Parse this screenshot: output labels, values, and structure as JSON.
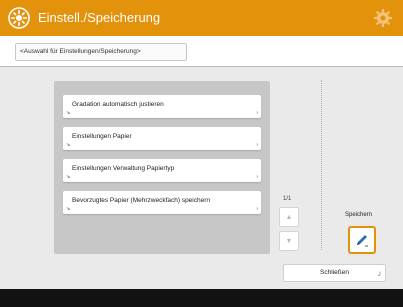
{
  "header": {
    "title": "Einstell./Speicherung",
    "brand_color": "#e2920b"
  },
  "breadcrumb": {
    "text": "<Auswahl für Einstellungen/Speicherung>"
  },
  "menu": {
    "items": [
      {
        "label": "Gradation automatisch justieren"
      },
      {
        "label": "Einstellungen Papier"
      },
      {
        "label": "Einstellungen Verwaltung Papiertyp"
      },
      {
        "label": "Bevorzugtes Papier (Mehrzweckfach) speichern"
      }
    ]
  },
  "pager": {
    "page": "1/1"
  },
  "save": {
    "label": "Speichern"
  },
  "close": {
    "label": "Schließen"
  }
}
